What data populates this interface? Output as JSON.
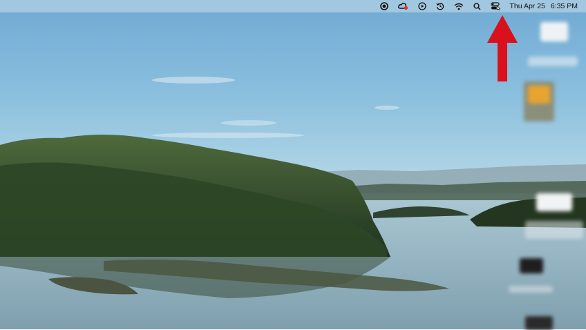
{
  "menubar": {
    "status_icons": [
      {
        "name": "record-icon"
      },
      {
        "name": "creative-cloud-icon"
      },
      {
        "name": "play-icon"
      },
      {
        "name": "time-machine-icon"
      },
      {
        "name": "wifi-icon"
      },
      {
        "name": "spotlight-search-icon"
      },
      {
        "name": "control-center-icon"
      }
    ],
    "date": "Thu Apr 25",
    "time": "6:35 PM"
  },
  "annotation": {
    "color": "#d9111c",
    "target": "control-center-icon"
  },
  "colors": {
    "menubar": "#aacde2",
    "sky_top": "#6fa9d4",
    "water": "#9bb7c4",
    "forest": "#2f4a26"
  }
}
